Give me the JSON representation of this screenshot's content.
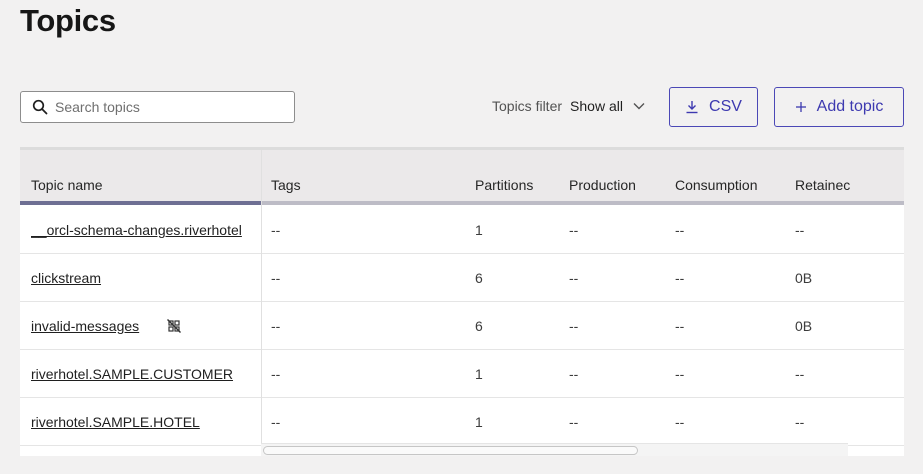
{
  "page": {
    "title": "Topics"
  },
  "search": {
    "placeholder": "Search topics",
    "value": ""
  },
  "filter": {
    "label": "Topics filter",
    "selected": "Show all"
  },
  "buttons": {
    "csv": "CSV",
    "add_topic": "Add topic"
  },
  "table": {
    "headers": [
      "Topic name",
      "Tags",
      "Partitions",
      "Production",
      "Consumption",
      "Retainec"
    ],
    "rows": [
      {
        "name": "__orcl-schema-changes.riverhotel",
        "tags": "--",
        "partitions": "1",
        "production": "--",
        "consumption": "--",
        "retained": "--"
      },
      {
        "name": "clickstream",
        "tags": "--",
        "partitions": "6",
        "production": "--",
        "consumption": "--",
        "retained": "0B"
      },
      {
        "name": "invalid-messages",
        "tags": "--",
        "partitions": "6",
        "production": "--",
        "consumption": "--",
        "retained": "0B",
        "icon": "no-schema-icon"
      },
      {
        "name": "riverhotel.SAMPLE.CUSTOMER",
        "tags": "--",
        "partitions": "1",
        "production": "--",
        "consumption": "--",
        "retained": "--"
      },
      {
        "name": "riverhotel.SAMPLE.HOTEL",
        "tags": "--",
        "partitions": "1",
        "production": "--",
        "consumption": "--",
        "retained": "--"
      }
    ]
  },
  "colors": {
    "accent": "#3d39b0",
    "header_bg": "#ebe9ea",
    "page_bg": "#f2f1f1"
  }
}
